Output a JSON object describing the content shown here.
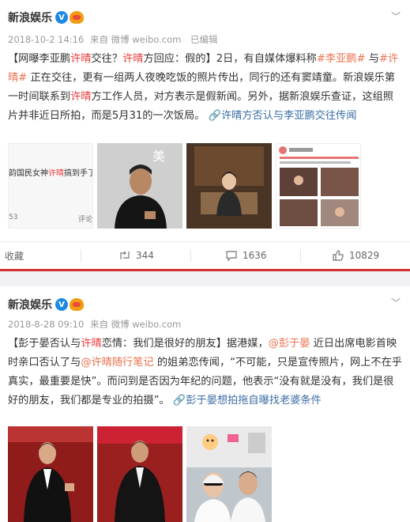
{
  "posts": [
    {
      "author": "新浪娱乐",
      "meta_date": "2018-10-2 14:16",
      "meta_source": "来自 微博 weibo.com",
      "meta_edited": "已编辑",
      "content": [
        {
          "t": "【网曝李亚鹏",
          "c": ""
        },
        {
          "t": "许晴",
          "c": "hl"
        },
        {
          "t": "交往？",
          "c": ""
        },
        {
          "t": "许晴",
          "c": "hl"
        },
        {
          "t": "方回应：假的】2日，有自媒体爆料称",
          "c": ""
        },
        {
          "t": "#李亚鹏#",
          "c": "lk"
        },
        {
          "t": " 与",
          "c": ""
        },
        {
          "t": "#许晴#",
          "c": "lk"
        },
        {
          "t": " 正在交往，更有一组两人夜晚吃饭的照片传出，同行的还有窦靖童。新浪娱乐第一时间联系到",
          "c": ""
        },
        {
          "t": "许晴",
          "c": "hl"
        },
        {
          "t": "方工作人员，对方表示是假新闻。另外，据新浪娱乐查证，这组照片并非近日所拍，而是5月31的一次饭局。 ",
          "c": ""
        },
        {
          "t": "🔗许晴方否认与李亚鹏交往传闻",
          "c": "blue"
        }
      ],
      "preview_text_a": "韵国民女神",
      "preview_text_hl": "许晴",
      "preview_text_b": "搞到手了...",
      "preview_count": "53",
      "preview_comment": "评论",
      "actions": {
        "collect": "收藏",
        "repost": "344",
        "comment": "1636",
        "like": "10829"
      }
    },
    {
      "author": "新浪娱乐",
      "meta_date": "2018-8-28 09:10",
      "meta_source": "来自 微博 weibo.com",
      "content": [
        {
          "t": "【彭于晏否认与",
          "c": ""
        },
        {
          "t": "许晴",
          "c": "hl"
        },
        {
          "t": "恋情：我们是很好的朋友】据港媒，",
          "c": ""
        },
        {
          "t": "@彭于晏",
          "c": "lk"
        },
        {
          "t": " 近日出席电影首映时亲口否认了与",
          "c": ""
        },
        {
          "t": "@许晴",
          "c": "lk-hl"
        },
        {
          "t": "随行笔记",
          "c": "lk"
        },
        {
          "t": " 的姐弟恋传闻，“不可能，只是宣传照片，网上不在乎真实，最重要是快”。而问到是否因为年纪的问题，他表示“没有就是没有，我们是很好的朋友，我们都是专业的拍摄”。 ",
          "c": ""
        },
        {
          "t": "🔗彭于晏想拍拖自曝找老婆条件",
          "c": "blue"
        }
      ]
    }
  ],
  "icons": {
    "chevron": "chevron-down-icon",
    "repost": "repost-icon",
    "comment": "comment-icon",
    "like": "like-icon"
  },
  "colors": {
    "highlight": "#eb3a3a",
    "link": "#eb7350",
    "blue_link": "#3a6ea5",
    "divider": "#d32f2f"
  }
}
